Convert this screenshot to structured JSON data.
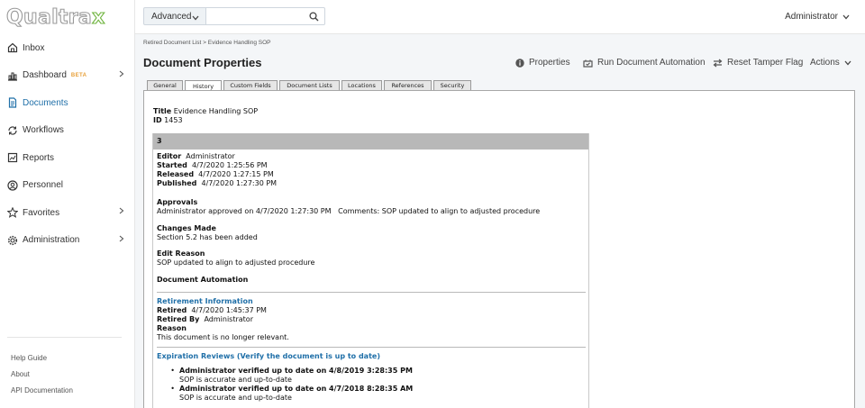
{
  "logo": {
    "text_a": "Qualtra",
    "text_b": "x"
  },
  "sidebar": {
    "items": [
      {
        "label": "Inbox",
        "icon": "inbox-icon"
      },
      {
        "label": "Dashboard",
        "badge": "BETA",
        "icon": "dashboard-icon"
      },
      {
        "label": "Documents",
        "icon": "document-icon"
      },
      {
        "label": "Workflows",
        "icon": "workflow-icon"
      },
      {
        "label": "Reports",
        "icon": "reports-icon"
      },
      {
        "label": "Personnel",
        "icon": "personnel-icon"
      },
      {
        "label": "Favorites",
        "icon": "star-icon"
      },
      {
        "label": "Administration",
        "icon": "gear-icon"
      }
    ],
    "footer": [
      "Help Guide",
      "About",
      "API Documentation"
    ]
  },
  "topbar": {
    "search_mode": "Advanced",
    "search_placeholder": "",
    "user": "Administrator"
  },
  "breadcrumb": {
    "root": "Retired Document List",
    "sep": " > ",
    "current": "Evidence Handling SOP"
  },
  "page_title": "Document Properties",
  "actions": {
    "properties": "Properties",
    "run_automation": "Run Document Automation",
    "reset_tamper": "Reset Tamper Flag",
    "actions": "Actions"
  },
  "tabs": [
    "General",
    "History",
    "Custom Fields",
    "Document Lists",
    "Locations",
    "References",
    "Security"
  ],
  "active_tab": "History",
  "document": {
    "title_label": "Title",
    "title": "Evidence Handling SOP",
    "id_label": "ID",
    "id": "1453"
  },
  "revision": {
    "number": "3",
    "editor_label": "Editor",
    "editor": "Administrator",
    "started_label": "Started",
    "started": "4/7/2020 1:25:56 PM",
    "released_label": "Released",
    "released": "4/7/2020 1:27:15 PM",
    "published_label": "Published",
    "published": "4/7/2020 1:27:30 PM",
    "approvals_label": "Approvals",
    "approval_text": "Administrator approved on 4/7/2020 1:27:30 PM",
    "approval_comments": "Comments: SOP updated to align to adjusted procedure",
    "changes_label": "Changes Made",
    "changes": "Section 5.2 has been added",
    "edit_reason_label": "Edit Reason",
    "edit_reason": "SOP updated to align to adjusted procedure",
    "automation_label": "Document Automation"
  },
  "retirement": {
    "heading": "Retirement Information",
    "retired_label": "Retired",
    "retired": "4/7/2020 1:45:37 PM",
    "retired_by_label": "Retired By",
    "retired_by": "Administrator",
    "reason_label": "Reason",
    "reason": "This document is no longer relevant."
  },
  "expiration": {
    "heading": "Expiration Reviews (Verify the document is up to date)",
    "reviews": [
      {
        "title": "Administrator verified up to date on 4/8/2019 3:28:35 PM",
        "note": "SOP is accurate and up-to-date"
      },
      {
        "title": "Administrator verified up to date on 4/7/2018 8:28:35 AM",
        "note": "SOP is accurate and up-to-date"
      }
    ]
  },
  "colors": {
    "accent": "#1f6fa8",
    "beta": "#e8a03a",
    "logo_x": "#6fb43f",
    "revision_bar": "#b8b8b8"
  }
}
